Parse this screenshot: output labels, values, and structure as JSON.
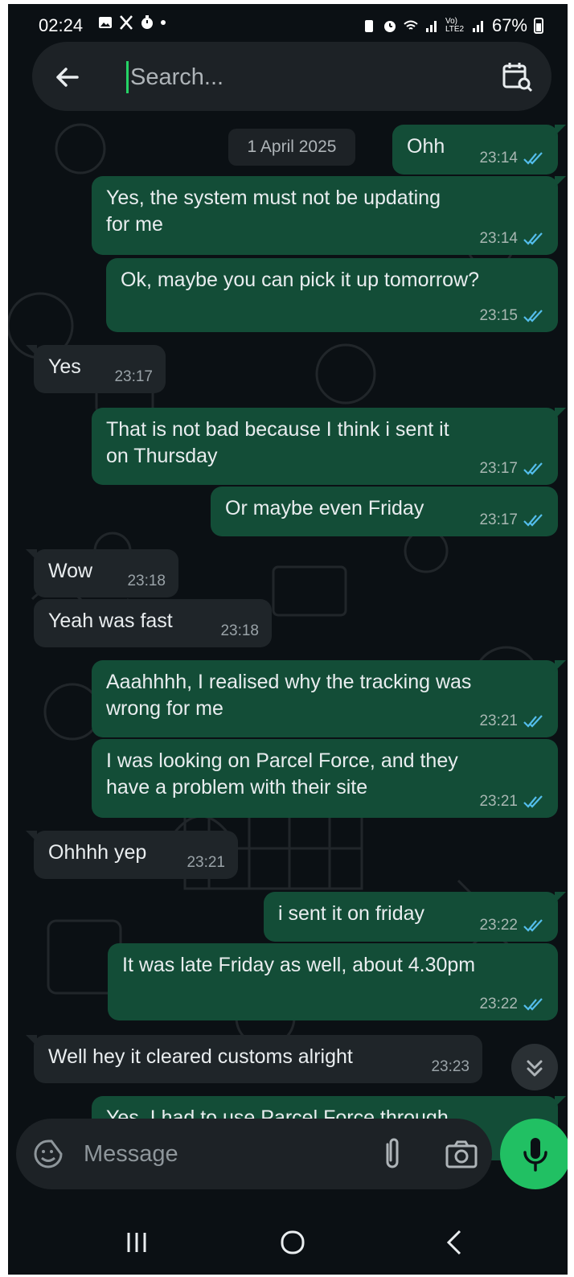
{
  "status_bar": {
    "time": "02:24",
    "network": "Vo) LTE2",
    "battery": "67%"
  },
  "search": {
    "placeholder": "Search..."
  },
  "date_chip": "1 April 2025",
  "messages": [
    {
      "dir": "out",
      "text": "Ohh",
      "time": "23:14"
    },
    {
      "dir": "out",
      "text": "Yes, the system must not be updating\nfor me",
      "time": "23:14"
    },
    {
      "dir": "out",
      "text": "Ok, maybe you can pick it up tomorrow?",
      "time": "23:15"
    },
    {
      "dir": "in",
      "text": "Yes",
      "time": "23:17"
    },
    {
      "dir": "out",
      "text": "That is not bad because I think i sent it\non Thursday",
      "time": "23:17"
    },
    {
      "dir": "out",
      "text": "Or maybe even Friday",
      "time": "23:17"
    },
    {
      "dir": "in",
      "text": "Wow",
      "time": "23:18"
    },
    {
      "dir": "in",
      "text": "Yeah was fast",
      "time": "23:18"
    },
    {
      "dir": "out",
      "text": "Aaahhhh, I realised why the tracking was\nwrong for me",
      "time": "23:21"
    },
    {
      "dir": "out",
      "text": "I was looking on Parcel Force, and they\nhave a problem with their site",
      "time": "23:21"
    },
    {
      "dir": "in",
      "text": "Ohhhh yep",
      "time": "23:21"
    },
    {
      "dir": "out",
      "text": "i sent it on friday",
      "time": "23:22"
    },
    {
      "dir": "out",
      "text": "It was late Friday as well, about 4.30pm",
      "time": "23:22"
    },
    {
      "dir": "in",
      "text": "Well hey it cleared customs alright",
      "time": "23:23"
    },
    {
      "dir": "out",
      "text": "Yes, I had to use Parcel Force through",
      "time": ""
    }
  ],
  "composer": {
    "placeholder": "Message"
  },
  "icons": {
    "back": "arrow-left-icon",
    "calendar_search": "calendar-search-icon",
    "emoji": "sticker-icon",
    "attach": "paperclip-icon",
    "camera": "camera-icon",
    "mic": "mic-icon",
    "scroll_down": "double-chevron-down-icon"
  },
  "colors": {
    "outgoing_bubble": "#134d37",
    "incoming_bubble": "#1f2529",
    "read_ticks": "#53bdeb",
    "mic_button": "#21c063"
  }
}
